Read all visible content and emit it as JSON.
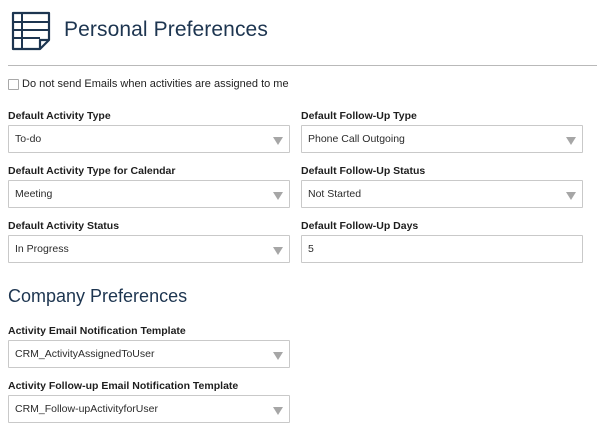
{
  "header": {
    "title": "Personal Preferences",
    "icon": "notes-list-icon"
  },
  "checkbox": {
    "label": "Do not send Emails when activities are assigned to me",
    "checked": false
  },
  "personal": {
    "default_activity_type": {
      "label": "Default Activity Type",
      "value": "To-do"
    },
    "default_followup_type": {
      "label": "Default Follow-Up Type",
      "value": "Phone Call Outgoing"
    },
    "default_activity_type_calendar": {
      "label": "Default Activity Type for Calendar",
      "value": "Meeting"
    },
    "default_followup_status": {
      "label": "Default Follow-Up Status",
      "value": "Not Started"
    },
    "default_activity_status": {
      "label": "Default Activity Status",
      "value": "In Progress"
    },
    "default_followup_days": {
      "label": "Default Follow-Up Days",
      "value": "5"
    }
  },
  "company": {
    "title": "Company Preferences",
    "activity_email_template": {
      "label": "Activity Email Notification Template",
      "value": "CRM_ActivityAssignedToUser"
    },
    "followup_email_template": {
      "label": "Activity Follow-up Email Notification Template",
      "value": "CRM_Follow-upActivityforUser"
    }
  },
  "colors": {
    "title": "#1d3550",
    "border": "#c9c9c9",
    "caret": "#a6a6a6"
  }
}
